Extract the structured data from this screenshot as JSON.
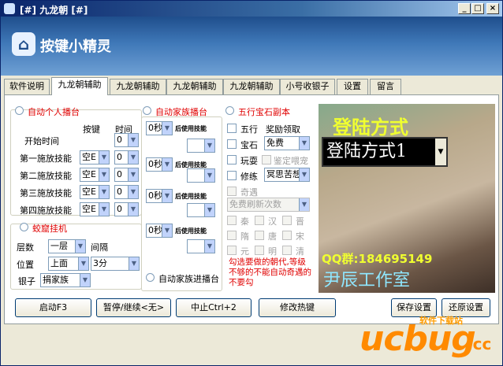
{
  "window": {
    "title": "[#] 九龙朝 [#]",
    "min": "_",
    "max": "□",
    "close": "×"
  },
  "banner": {
    "brand": "按键小精灵"
  },
  "tabs": [
    "软件说明",
    "九龙朝辅助",
    "九龙朝辅助",
    "九龙朝辅助",
    "九龙朝辅助",
    "小号收银子",
    "设置",
    "留言"
  ],
  "personal": {
    "label": "自动个人播台",
    "col_key": "按键",
    "col_time": "时间",
    "start_time": "开始时间",
    "start_val": "0",
    "rows": [
      {
        "label": "第一施放技能",
        "key": "空E",
        "time": "0"
      },
      {
        "label": "第二施放技能",
        "key": "空E",
        "time": "0"
      },
      {
        "label": "第三施放技能",
        "key": "空E",
        "time": "0"
      },
      {
        "label": "第四施放技能",
        "key": "空E",
        "time": "0"
      }
    ]
  },
  "cave": {
    "label": "蛟窟挂机",
    "layer_label": "层数",
    "layer_val": "一层",
    "interval_label": "间隔",
    "pos_label": "位置",
    "pos_val": "上面",
    "interval_val": "3分",
    "silver_label": "银子",
    "silver_val": "捐家族"
  },
  "family": {
    "label": "自动家族播台",
    "skill_label": "后使用技能",
    "slots": [
      {
        "val": "0秒"
      },
      {
        "val": "0秒"
      },
      {
        "val": "0秒"
      },
      {
        "val": "0秒"
      }
    ],
    "enter_label": "自动家族进播台"
  },
  "dungeon": {
    "label": "五行宝石副本",
    "wuxing": "五行",
    "reward_label": "奖励领取",
    "baoshi": "宝石",
    "reward_val": "免费",
    "wanshua": "玩耍",
    "appraise": "鉴定喂宠",
    "xiulian": "修练",
    "meditate_val": "冥思苦想",
    "qiyu": "奇遇",
    "refresh_val": "免费刷新次数",
    "dynasties": [
      "秦",
      "汉",
      "晋",
      "隋",
      "唐",
      "宋",
      "元",
      "明",
      "清"
    ],
    "note": "勾选要做的朝代,等级不够的不能自动奇遇的不要勾"
  },
  "ad": {
    "title": "登陆方式",
    "combo": "登陆方式1",
    "qq": "QQ群:184695149",
    "studio": "尹辰工作室"
  },
  "buttons": {
    "start": "启动F3",
    "pause": "暂停/继续<无>",
    "stop": "中止Ctrl+2",
    "hotkey": "修改热键",
    "save": "保存设置",
    "restore": "还原设置"
  },
  "watermark": {
    "site": "软件下载站",
    "logo": "ucbug",
    "tld": ".cc"
  }
}
